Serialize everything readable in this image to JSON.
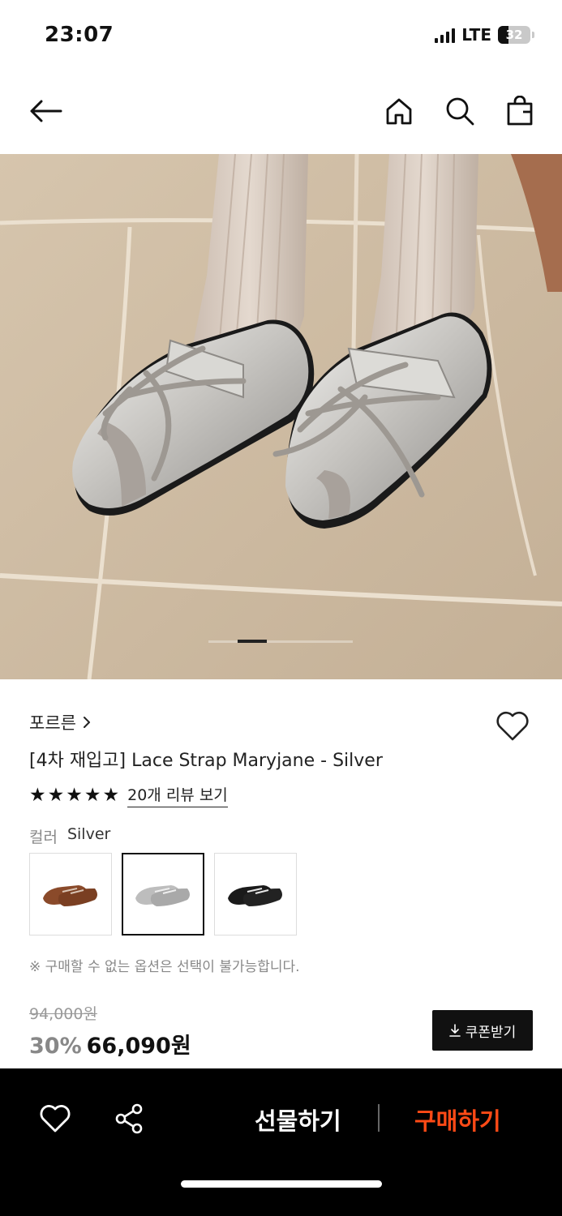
{
  "status_bar": {
    "time": "23:07",
    "network": "LTE",
    "battery": "32"
  },
  "product": {
    "brand": "포르른",
    "title": "[4차 재입고] Lace Strap Maryjane - Silver",
    "rating_stars": 5,
    "review_link": "20개 리뷰 보기",
    "color_label": "컬러",
    "color_value": "Silver",
    "swatches": [
      {
        "name": "brown",
        "color": "#8a4a2a"
      },
      {
        "name": "silver",
        "color": "#b8b8b8"
      },
      {
        "name": "black",
        "color": "#1a1a1a"
      }
    ],
    "note": "※ 구매할 수 없는 옵션은 선택이 불가능합니다.",
    "original_price": "94,000원",
    "discount": "30%",
    "price": "66,090원",
    "coupon_label": "쿠폰받기"
  },
  "bottom_bar": {
    "gift_label": "선물하기",
    "buy_label": "구매하기"
  },
  "colors": {
    "accent": "#ff4a16",
    "dark": "#111111"
  },
  "icons": [
    "back-arrow-icon",
    "home-icon",
    "search-icon",
    "shopping-bag-icon",
    "heart-icon",
    "share-icon",
    "download-icon"
  ]
}
